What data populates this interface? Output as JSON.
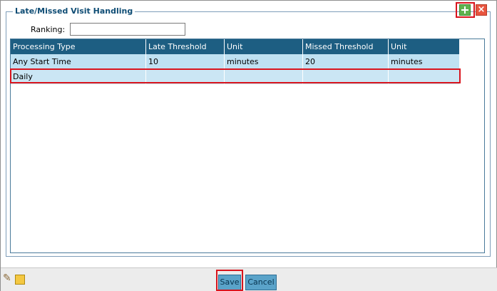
{
  "panel": {
    "title": "Late/Missed Visit Handling",
    "close_symbol": "×"
  },
  "ranking": {
    "label": "Ranking:",
    "value": ""
  },
  "table": {
    "headers": [
      "Processing Type",
      "Late Threshold",
      "Unit",
      "Missed Threshold",
      "Unit"
    ],
    "rows": [
      [
        "Any Start Time",
        "10",
        "minutes",
        "20",
        "minutes"
      ],
      [
        "Daily",
        "",
        "",
        "",
        ""
      ]
    ]
  },
  "footer": {
    "save_label": "Save",
    "cancel_label": "Cancel"
  },
  "icons": {
    "add": "plus-icon",
    "close": "close-icon",
    "edit": "pencil-icon",
    "note": "note-icon"
  },
  "colors": {
    "header_bg": "#1d5e82",
    "selected_row_bg": "#bfe1f2",
    "button_bg": "#5aa3c9",
    "highlight": "#d9141d"
  }
}
